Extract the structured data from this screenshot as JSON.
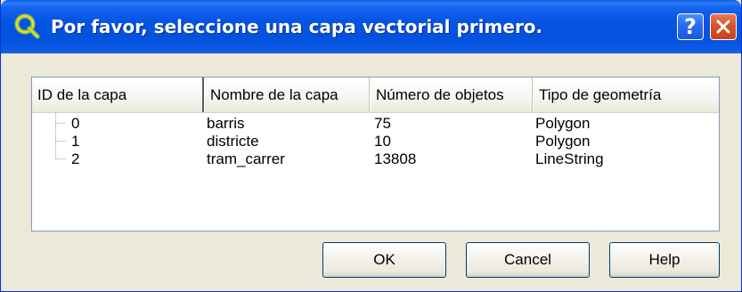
{
  "window": {
    "title": "Por favor, seleccione una capa vectorial primero.",
    "help_glyph": "?",
    "accent_color": "#0554e3"
  },
  "table": {
    "columns": [
      "ID de la capa",
      "Nombre de la capa",
      "Número de objetos",
      "Tipo de geometría"
    ],
    "rows": [
      {
        "id": "0",
        "name": "barris",
        "count": "75",
        "geometry": "Polygon"
      },
      {
        "id": "1",
        "name": "districte",
        "count": "10",
        "geometry": "Polygon"
      },
      {
        "id": "2",
        "name": "tram_carrer",
        "count": "13808",
        "geometry": "LineString"
      }
    ]
  },
  "buttons": {
    "ok": "OK",
    "cancel": "Cancel",
    "help": "Help"
  },
  "icons": {
    "app": "qgis-icon",
    "help": "help-icon",
    "close": "close-icon"
  }
}
